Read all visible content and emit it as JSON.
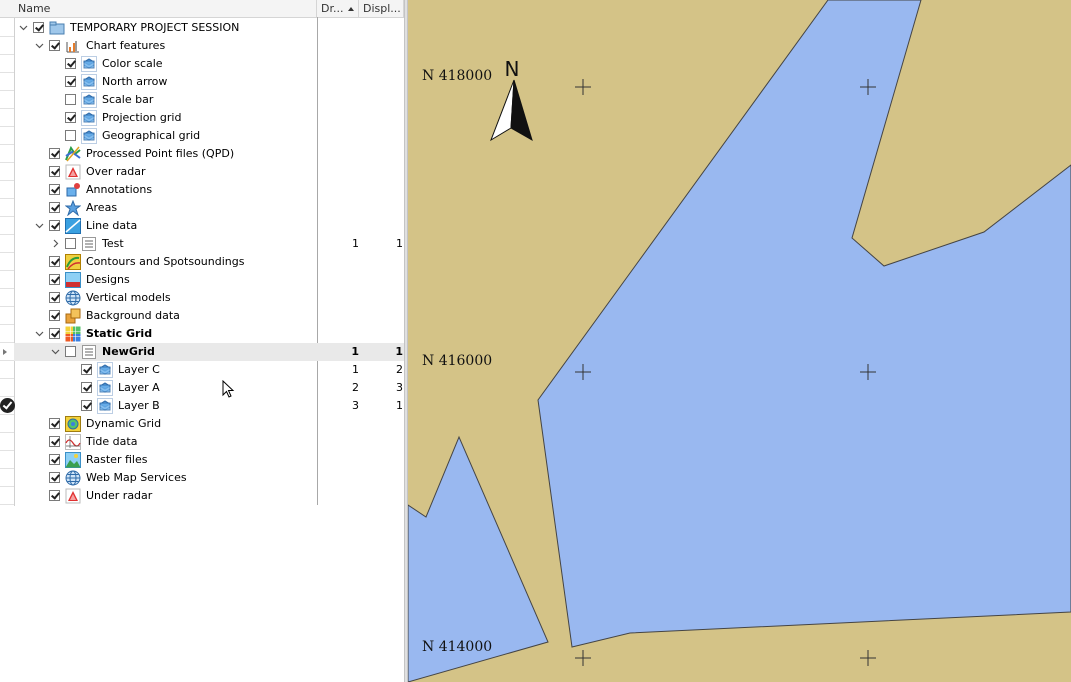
{
  "columns": {
    "name": "Name",
    "draw_order": "Dr...",
    "display": "Displ..."
  },
  "tree": [
    {
      "label": "TEMPORARY PROJECT SESSION",
      "level": 0,
      "expander": "down",
      "checked": true,
      "icon": "project-icon",
      "bold": false
    },
    {
      "label": "Chart features",
      "level": 1,
      "expander": "down",
      "checked": true,
      "icon": "chart-features-icon",
      "bold": false
    },
    {
      "label": "Color scale",
      "level": 2,
      "expander": "",
      "checked": true,
      "icon": "layer-icon",
      "bold": false
    },
    {
      "label": "North arrow",
      "level": 2,
      "expander": "",
      "checked": true,
      "icon": "layer-icon",
      "bold": false
    },
    {
      "label": "Scale bar",
      "level": 2,
      "expander": "",
      "checked": false,
      "icon": "layer-icon",
      "bold": false
    },
    {
      "label": "Projection grid",
      "level": 2,
      "expander": "",
      "checked": true,
      "icon": "layer-icon",
      "bold": false
    },
    {
      "label": "Geographical grid",
      "level": 2,
      "expander": "",
      "checked": false,
      "icon": "layer-icon",
      "bold": false
    },
    {
      "label": "Processed Point files (QPD)",
      "level": 1,
      "expander": "",
      "checked": true,
      "icon": "qpd-icon",
      "bold": false
    },
    {
      "label": "Over radar",
      "level": 1,
      "expander": "",
      "checked": true,
      "icon": "radar-icon",
      "bold": false
    },
    {
      "label": "Annotations",
      "level": 1,
      "expander": "",
      "checked": true,
      "icon": "annotations-icon",
      "bold": false
    },
    {
      "label": "Areas",
      "level": 1,
      "expander": "",
      "checked": true,
      "icon": "areas-icon",
      "bold": false
    },
    {
      "label": "Line data",
      "level": 1,
      "expander": "down",
      "checked": true,
      "icon": "line-data-icon",
      "bold": false
    },
    {
      "label": "Test",
      "level": 2,
      "expander": "right",
      "checked": false,
      "icon": "list-icon",
      "bold": false,
      "dr": "1",
      "disp": "1"
    },
    {
      "label": "Contours and Spotsoundings",
      "level": 1,
      "expander": "",
      "checked": true,
      "icon": "contours-icon",
      "bold": false
    },
    {
      "label": "Designs",
      "level": 1,
      "expander": "",
      "checked": true,
      "icon": "designs-icon",
      "bold": false
    },
    {
      "label": "Vertical models",
      "level": 1,
      "expander": "",
      "checked": true,
      "icon": "globe-icon",
      "bold": false
    },
    {
      "label": "Background data",
      "level": 1,
      "expander": "",
      "checked": true,
      "icon": "background-data-icon",
      "bold": false
    },
    {
      "label": "Static Grid",
      "level": 1,
      "expander": "down",
      "checked": true,
      "icon": "static-grid-icon",
      "bold": true
    },
    {
      "label": "NewGrid",
      "level": 2,
      "expander": "down",
      "checked": false,
      "icon": "list-icon",
      "bold": true,
      "dr": "1",
      "disp": "1",
      "selected": true
    },
    {
      "label": "Layer C",
      "level": 3,
      "expander": "",
      "checked": true,
      "icon": "layer-icon",
      "bold": false,
      "dr": "1",
      "disp": "2"
    },
    {
      "label": "Layer A",
      "level": 3,
      "expander": "",
      "checked": true,
      "icon": "layer-icon",
      "bold": false,
      "dr": "2",
      "disp": "3"
    },
    {
      "label": "Layer B",
      "level": 3,
      "expander": "",
      "checked": true,
      "icon": "layer-icon",
      "bold": false,
      "dr": "3",
      "disp": "1"
    },
    {
      "label": "Dynamic Grid",
      "level": 1,
      "expander": "",
      "checked": true,
      "icon": "dynamic-grid-icon",
      "bold": false
    },
    {
      "label": "Tide data",
      "level": 1,
      "expander": "",
      "checked": true,
      "icon": "tide-icon",
      "bold": false
    },
    {
      "label": "Raster files",
      "level": 1,
      "expander": "",
      "checked": true,
      "icon": "raster-icon",
      "bold": false
    },
    {
      "label": "Web Map Services",
      "level": 1,
      "expander": "",
      "checked": true,
      "icon": "globe-icon",
      "bold": false
    },
    {
      "label": "Under radar",
      "level": 1,
      "expander": "",
      "checked": true,
      "icon": "radar-icon",
      "bold": false
    }
  ],
  "map": {
    "north_letter": "N",
    "grid_labels": [
      "N 418000",
      "N 416000",
      "N 414000"
    ],
    "water_color": "#99b8f0",
    "land_color": "#d4c387"
  }
}
